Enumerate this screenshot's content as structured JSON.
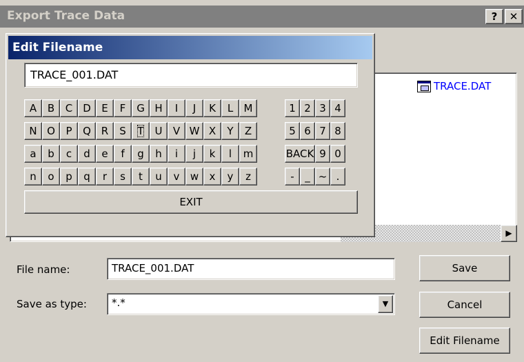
{
  "dialog": {
    "title": "Export Trace Data",
    "help_label": "?",
    "close_label": "✕"
  },
  "file_list": {
    "items": [
      {
        "name": "TRACE.DAT",
        "icon": "data-file-icon"
      }
    ]
  },
  "form": {
    "filename_label": "File name:",
    "filename_value": "TRACE_001.DAT",
    "type_label": "Save as type:",
    "type_value": "*.*"
  },
  "buttons": {
    "save": "Save",
    "cancel": "Cancel",
    "edit_filename": "Edit Filename"
  },
  "popup": {
    "title": "Edit Filename",
    "value": "TRACE_001.DAT",
    "letter_rows": [
      [
        "A",
        "B",
        "C",
        "D",
        "E",
        "F",
        "G",
        "H",
        "I",
        "J",
        "K",
        "L",
        "M"
      ],
      [
        "N",
        "O",
        "P",
        "Q",
        "R",
        "S",
        "T",
        "U",
        "V",
        "W",
        "X",
        "Y",
        "Z"
      ],
      [
        "a",
        "b",
        "c",
        "d",
        "e",
        "f",
        "g",
        "h",
        "i",
        "j",
        "k",
        "l",
        "m"
      ],
      [
        "n",
        "o",
        "p",
        "q",
        "r",
        "s",
        "t",
        "u",
        "v",
        "w",
        "x",
        "y",
        "z"
      ]
    ],
    "focused_key": "T",
    "symbol_rows": [
      [
        "1",
        "2",
        "3",
        "4"
      ],
      [
        "5",
        "6",
        "7",
        "8"
      ],
      [
        "BACK",
        "9",
        "0"
      ],
      [
        "-",
        "_",
        "~",
        "."
      ]
    ],
    "exit_label": "EXIT"
  },
  "colors": {
    "window_bg": "#d4d0c8",
    "popup_title_start": "#0a246a",
    "popup_title_end": "#a6caf0",
    "link_blue": "#0000ff"
  }
}
